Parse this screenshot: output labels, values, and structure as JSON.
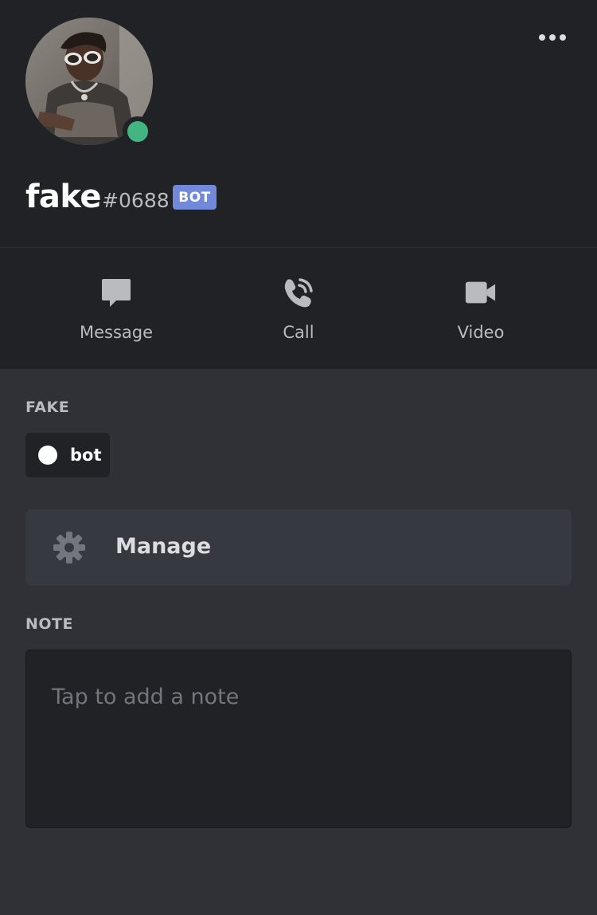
{
  "profile": {
    "username": "fake",
    "discriminator": "#0688",
    "bot_tag": "BOT",
    "status": "online",
    "status_color": "#43b581"
  },
  "actions": [
    {
      "label": "Message",
      "icon": "chat-bubble-icon"
    },
    {
      "label": "Call",
      "icon": "phone-call-icon"
    },
    {
      "label": "Video",
      "icon": "video-camera-icon"
    }
  ],
  "roles_section": {
    "title": "FAKE",
    "roles": [
      {
        "name": "bot",
        "color": "#ffffff"
      }
    ]
  },
  "manage": {
    "label": "Manage",
    "icon": "gear-icon"
  },
  "note": {
    "title": "NOTE",
    "placeholder": "Tap to add a note"
  },
  "colors": {
    "header_bg": "#202225",
    "body_bg": "#2f3136",
    "accent": "#7289da"
  }
}
